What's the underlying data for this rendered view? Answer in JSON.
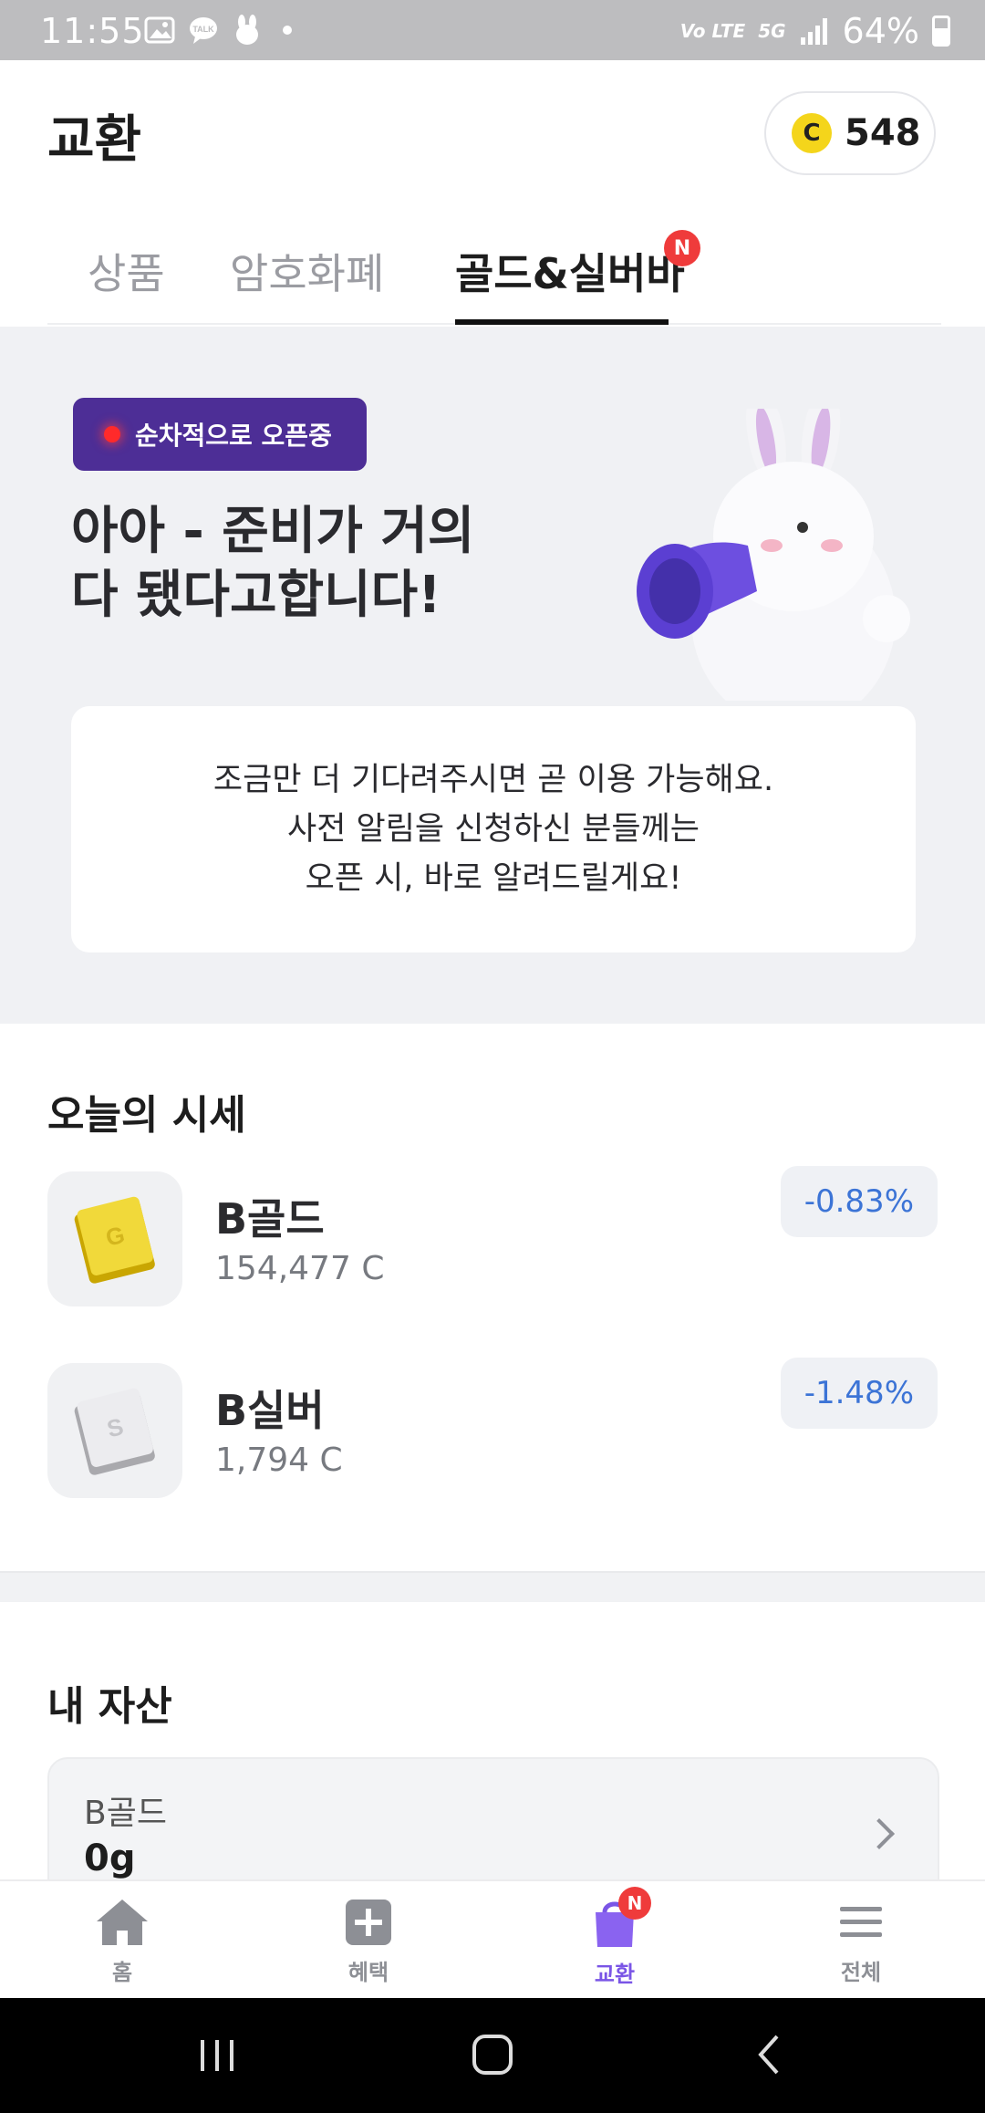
{
  "status_bar": {
    "time": "11:55",
    "network": "Vo LTE",
    "network_5g": "5G",
    "battery": "64%",
    "icons": [
      "gallery-icon",
      "talk-icon",
      "rabbit-icon",
      "dot-icon",
      "signal-icon",
      "battery-icon"
    ]
  },
  "header": {
    "title": "교환",
    "coin_symbol": "C",
    "coin_balance": "548"
  },
  "tabs": [
    {
      "label": "상품",
      "active": false
    },
    {
      "label": "암호화폐",
      "active": false
    },
    {
      "label": "골드&실버바",
      "active": true,
      "badge": "N"
    }
  ],
  "hero": {
    "chip": "순차적으로 오픈중",
    "headline_line1": "아아 - 준비가 거의",
    "headline_line2": "다 됐다고합니다!",
    "message_line1": "조금만 더 기다려주시면 곧 이용 가능해요.",
    "message_line2": "사전 알림을 신청하신 분들께는",
    "message_line3": "오픈 시, 바로 알려드릴게요!"
  },
  "prices": {
    "title": "오늘의 시세",
    "items": [
      {
        "name": "B골드",
        "price": "154,477 C",
        "change": "-0.83%",
        "thumb_letter": "G"
      },
      {
        "name": "B실버",
        "price": "1,794 C",
        "change": "-1.48%",
        "thumb_letter": "S"
      }
    ]
  },
  "my_assets": {
    "title": "내 자산",
    "card_label": "B골드",
    "card_value": "0g"
  },
  "bottom_nav": [
    {
      "label": "홈",
      "icon": "home-icon",
      "active": false
    },
    {
      "label": "혜택",
      "icon": "plus-box-icon",
      "active": false
    },
    {
      "label": "교환",
      "icon": "shopping-bag-icon",
      "active": true,
      "badge": "N"
    },
    {
      "label": "전체",
      "icon": "menu-icon",
      "active": false
    }
  ],
  "colors": {
    "accent_purple": "#7a55e6",
    "chip_purple": "#4d2e96",
    "badge_red": "#ef3b3b",
    "change_blue": "#3c74d6",
    "coin_yellow": "#f4d51b"
  }
}
